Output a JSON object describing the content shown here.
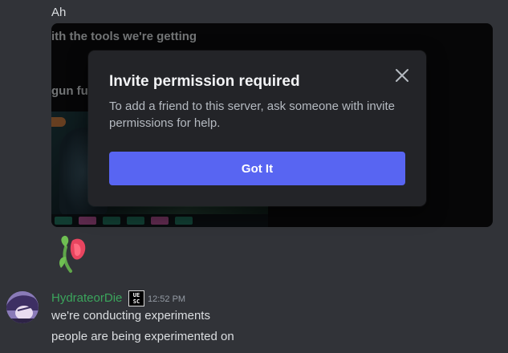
{
  "chat": {
    "earlier_message": "Ah",
    "embed_overlay_line_1": "ith the tools we're getting",
    "embed_overlay_line_2": "gun fuc"
  },
  "modal": {
    "title": "Invite permission required",
    "body": "To add a friend to this server, ask someone with invite permissions for help.",
    "button_label": "Got It",
    "close_icon": "close-icon",
    "accent_color": "#5865f2"
  },
  "message": {
    "username": "HydrateorDie",
    "username_color": "#3ba55c",
    "role_badge_line_1": "UE",
    "role_badge_line_2": "SC",
    "timestamp": "12:52 PM",
    "lines": [
      "we're conducting experiments",
      "people are being experimented on"
    ]
  },
  "icons": {
    "sticker": "wilted-rose-icon",
    "avatar": "avatar"
  }
}
